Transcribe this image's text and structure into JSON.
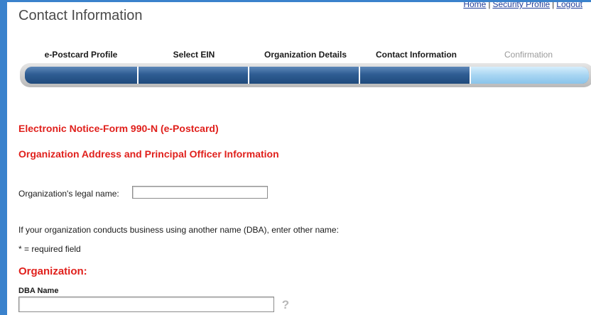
{
  "header": {
    "title": "Contact Information",
    "links": [
      {
        "label": "Home"
      },
      {
        "label": "Security Profile"
      },
      {
        "label": "Logout"
      }
    ],
    "separator": "|"
  },
  "steps": [
    {
      "label": "e-Postcard Profile",
      "state": "complete"
    },
    {
      "label": "Select EIN",
      "state": "complete"
    },
    {
      "label": "Organization Details",
      "state": "complete"
    },
    {
      "label": "Contact Information",
      "state": "current"
    },
    {
      "label": "Confirmation",
      "state": "pending"
    }
  ],
  "form": {
    "heading": "Electronic Notice-Form 990-N (e-Postcard)",
    "subheading": "Organization Address and Principal Officer Information",
    "legal_name_label": "Organization's legal name:",
    "legal_name_value": "",
    "dba_description": "If your organization conducts business using another name (DBA), enter other name:",
    "required_note": "* = required field",
    "section_title": "Organization:",
    "dba_name_label": "DBA Name",
    "dba_name_value": ""
  },
  "icons": {
    "help": "help-question-icon"
  },
  "colors": {
    "accent_red": "#e0201c",
    "progress_complete": "#2f5d93",
    "progress_pending": "#a7d5f2",
    "link": "#1f3d99",
    "frame": "#3a82cc"
  }
}
